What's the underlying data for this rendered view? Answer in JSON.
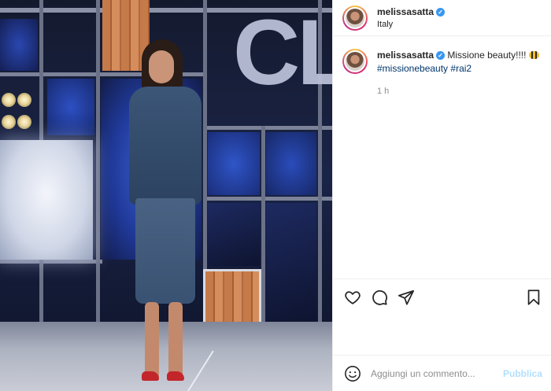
{
  "post": {
    "username": "melissasatta",
    "location": "Italy",
    "caption_text": "Missione beauty!!!!",
    "caption_emoji": "bee-emoji",
    "hashtags": [
      "#missionebeauty",
      "#rai2"
    ],
    "time_ago": "1 h",
    "verified_icon": "verified-badge-icon"
  },
  "photo": {
    "stage_letters": "CL"
  },
  "actions": {
    "icons": [
      "heart-icon",
      "comment-icon",
      "share-icon",
      "bookmark-icon"
    ]
  },
  "comment": {
    "placeholder": "Aggiungi un commento...",
    "publish_label": "Pubblica",
    "emoji_icon": "smiley-icon"
  },
  "colors": {
    "hashtag": "#00376b",
    "publish_disabled": "#b2dffc",
    "verified": "#3897f0"
  }
}
